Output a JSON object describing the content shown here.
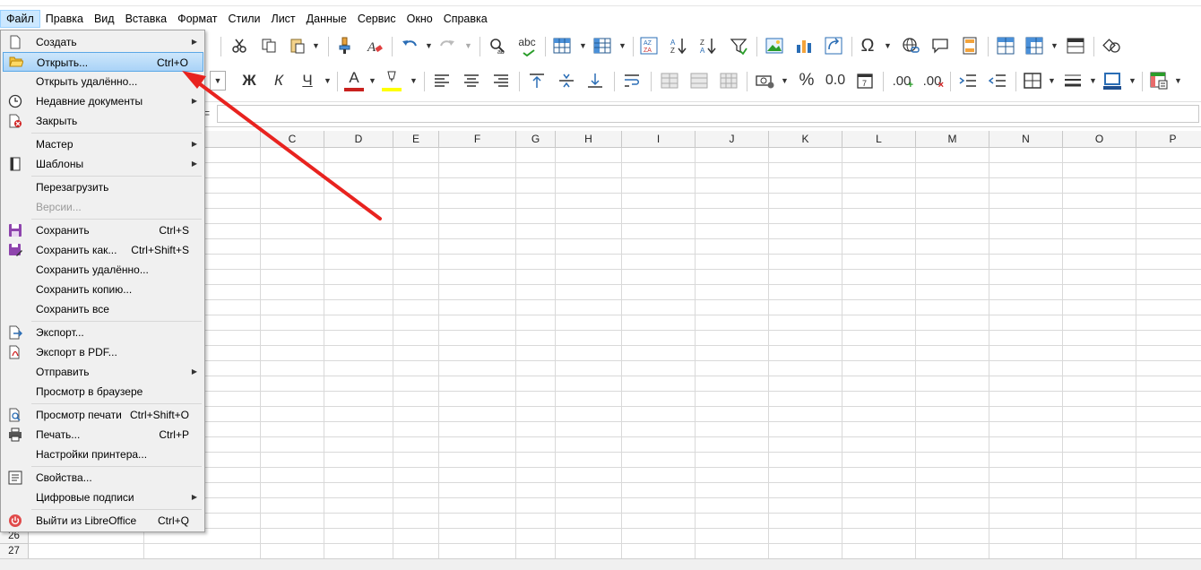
{
  "menubar": {
    "items": [
      "Файл",
      "Правка",
      "Вид",
      "Вставка",
      "Формат",
      "Стили",
      "Лист",
      "Данные",
      "Сервис",
      "Окно",
      "Справка"
    ]
  },
  "toolbar2": {
    "bold": "Ж",
    "italic": "К",
    "underline": "Ч",
    "font_color_letter": "А",
    "percent": "%",
    "decimal": "0.0",
    "add_decimal": ".00",
    "remove_decimal": ".00"
  },
  "toolbar1": {
    "spell_label": "abc"
  },
  "formula_bar": {
    "eq": "="
  },
  "columns": [
    "C",
    "D",
    "E",
    "F",
    "G",
    "H",
    "I",
    "J",
    "K",
    "L",
    "M",
    "N",
    "O",
    "P"
  ],
  "rows": [
    "26",
    "27"
  ],
  "file_menu": {
    "items": [
      {
        "label": "Создать",
        "icon": "new-document-icon",
        "shortcut": "",
        "submenu": true
      },
      {
        "label": "Открыть...",
        "icon": "folder-open-icon",
        "shortcut": "Ctrl+O",
        "highlighted": true
      },
      {
        "label": "Открыть удалённо...",
        "icon": "",
        "shortcut": ""
      },
      {
        "label": "Недавние документы",
        "icon": "recent-clock-icon",
        "shortcut": "",
        "submenu": true
      },
      {
        "label": "Закрыть",
        "icon": "close-document-icon",
        "shortcut": ""
      },
      {
        "label": "Мастер",
        "icon": "",
        "shortcut": "",
        "submenu": true
      },
      {
        "label": "Шаблоны",
        "icon": "templates-icon",
        "shortcut": "",
        "submenu": true
      },
      {
        "label": "Перезагрузить",
        "icon": "",
        "shortcut": ""
      },
      {
        "label": "Версии...",
        "icon": "",
        "shortcut": "",
        "disabled": true
      },
      {
        "label": "Сохранить",
        "icon": "save-icon",
        "shortcut": "Ctrl+S"
      },
      {
        "label": "Сохранить как...",
        "icon": "save-as-icon",
        "shortcut": "Ctrl+Shift+S"
      },
      {
        "label": "Сохранить удалённо...",
        "icon": "",
        "shortcut": ""
      },
      {
        "label": "Сохранить копию...",
        "icon": "",
        "shortcut": ""
      },
      {
        "label": "Сохранить все",
        "icon": "",
        "shortcut": ""
      },
      {
        "label": "Экспорт...",
        "icon": "export-icon",
        "shortcut": ""
      },
      {
        "label": "Экспорт в PDF...",
        "icon": "export-pdf-icon",
        "shortcut": ""
      },
      {
        "label": "Отправить",
        "icon": "",
        "shortcut": "",
        "submenu": true
      },
      {
        "label": "Просмотр в браузере",
        "icon": "",
        "shortcut": ""
      },
      {
        "label": "Просмотр печати",
        "icon": "print-preview-icon",
        "shortcut": "Ctrl+Shift+O"
      },
      {
        "label": "Печать...",
        "icon": "printer-icon",
        "shortcut": "Ctrl+P"
      },
      {
        "label": "Настройки принтера...",
        "icon": "",
        "shortcut": ""
      },
      {
        "label": "Свойства...",
        "icon": "properties-icon",
        "shortcut": ""
      },
      {
        "label": "Цифровые подписи",
        "icon": "",
        "shortcut": "",
        "submenu": true
      },
      {
        "label": "Выйти из LibreOffice",
        "icon": "power-icon",
        "shortcut": "Ctrl+Q"
      }
    ]
  },
  "colors": {
    "menu_highlight": "#cce8ff",
    "annotation_arrow": "#e8231f",
    "font_color_bar": "#c9211e",
    "highlight_bar": "#ffff00"
  }
}
